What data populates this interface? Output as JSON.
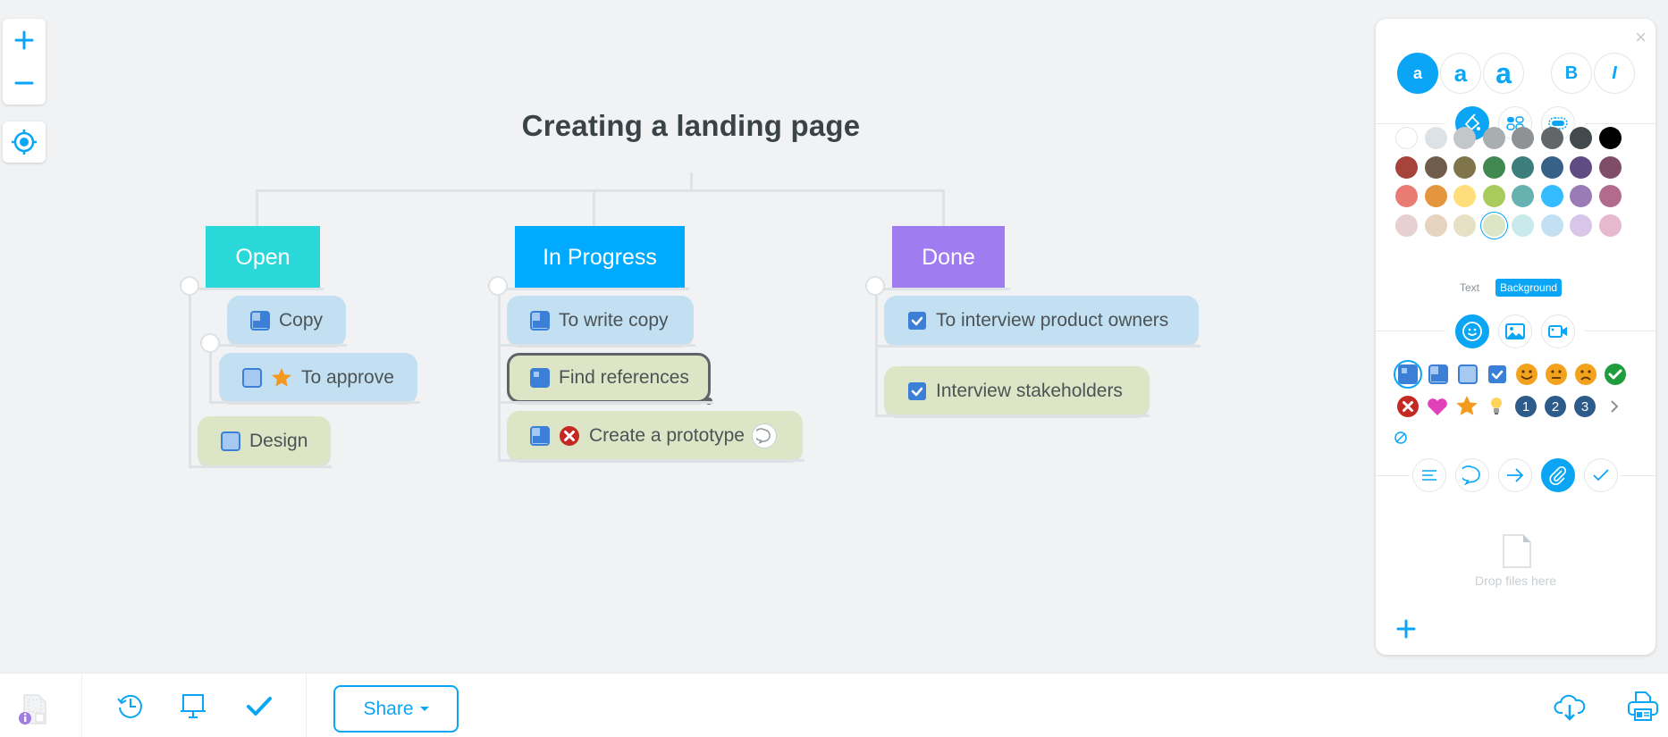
{
  "zoom_controls": {
    "zoom_in": "+",
    "zoom_out": "−",
    "locate": "locate-icon"
  },
  "map": {
    "title": "Creating a landing page",
    "categories": [
      {
        "label": "Open",
        "color": "#2ad8da",
        "items": [
          {
            "label": "Copy",
            "style": "blue",
            "icons": [
              "task-half-icon"
            ]
          },
          {
            "label": "To approve",
            "style": "blue",
            "icons": [
              "task-empty-icon",
              "star-icon"
            ]
          },
          {
            "label": "Design",
            "style": "green",
            "icons": [
              "task-empty-icon"
            ]
          }
        ]
      },
      {
        "label": "In Progress",
        "color": "#00aaff",
        "items": [
          {
            "label": "To write copy",
            "style": "blue",
            "icons": [
              "task-half-icon"
            ]
          },
          {
            "label": "Find references",
            "style": "green",
            "icons": [
              "task-quarter-icon"
            ],
            "selected": true
          },
          {
            "label": "Create a prototype",
            "style": "green",
            "icons": [
              "task-half-icon",
              "cross-icon"
            ],
            "badge": "comment-icon"
          }
        ]
      },
      {
        "label": "Done",
        "color": "#a07cf1",
        "items": [
          {
            "label": "To interview product owners",
            "style": "blue",
            "icons": [
              "task-done-icon"
            ]
          },
          {
            "label": "Interview stakeholders",
            "style": "green",
            "icons": [
              "task-done-icon"
            ]
          }
        ]
      }
    ]
  },
  "panel": {
    "close": "×",
    "text_size_buttons": [
      "a",
      "a",
      "a"
    ],
    "bold": "B",
    "italic": "I",
    "style_tabs": [
      "paint-bucket-icon",
      "layout-icon",
      "shape-icon"
    ],
    "colors": [
      [
        "#ffffff",
        "#dde2e6",
        "#c2c7ca",
        "#a9aeb0",
        "#8e9294",
        "#626668",
        "#434a4d",
        "#000000"
      ],
      [
        "#a6433b",
        "#6f5c4a",
        "#7f744a",
        "#428951",
        "#3b7e7b",
        "#376187",
        "#5f4c83",
        "#7f4d68"
      ],
      [
        "#e87b74",
        "#e6953f",
        "#ffdd7b",
        "#a8cb5c",
        "#67b1b0",
        "#35bbff",
        "#9a7bb5",
        "#b26a8d"
      ],
      [
        "#e6d0d0",
        "#e6d4c1",
        "#e6e0c4",
        "#dce5c6",
        "#c8eaea",
        "#c3e0f2",
        "#d7c6e8",
        "#e6b9d1"
      ]
    ],
    "selected_color": "#dce5c6",
    "color_target_tabs": {
      "text": "Text",
      "background": "Background",
      "active": "Background"
    },
    "media_tabs": [
      "smiley-icon",
      "image-icon",
      "video-icon"
    ],
    "icons_row1": [
      "task-quarter-icon",
      "task-half-icon",
      "task-empty-icon",
      "task-done-icon",
      "smile-icon",
      "neutral-face-icon",
      "sad-face-icon",
      "check-green-icon"
    ],
    "icons_row2": [
      "cross-red-icon",
      "heart-icon",
      "star-icon",
      "lightbulb-icon",
      "number-1-icon",
      "number-2-icon",
      "number-3-icon",
      "chevron-right-icon"
    ],
    "numbers": [
      "1",
      "2",
      "3"
    ],
    "no_icon": "no-icon",
    "bottom_tabs": [
      "notes-icon",
      "comment-icon",
      "link-icon",
      "attachment-icon",
      "task-icon"
    ],
    "active_bottom_tab": "attachment-icon",
    "drop_text": "Drop files here",
    "add": "+"
  },
  "toolbar": {
    "share_label": "Share",
    "icons": [
      "map-info-icon",
      "history-icon",
      "presentation-icon",
      "check-icon",
      "cloud-download-icon",
      "print-icon"
    ]
  }
}
